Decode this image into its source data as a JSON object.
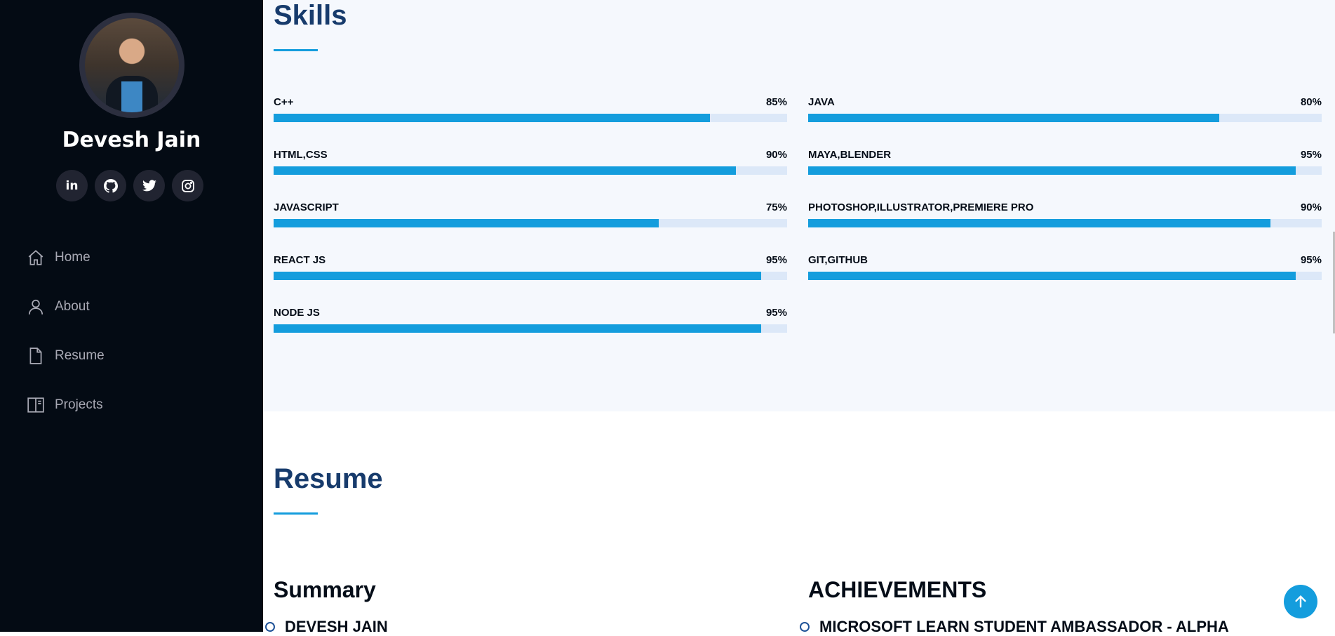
{
  "sidebar": {
    "name": "Devesh Jain",
    "social": [
      {
        "icon": "linkedin-icon",
        "glyph": "in"
      },
      {
        "icon": "github-icon",
        "glyph": ""
      },
      {
        "icon": "twitter-icon",
        "glyph": ""
      },
      {
        "icon": "instagram-icon",
        "glyph": ""
      }
    ],
    "nav": [
      {
        "label": "Home",
        "icon": "home-icon"
      },
      {
        "label": "About",
        "icon": "person-icon"
      },
      {
        "label": "Resume",
        "icon": "file-icon"
      },
      {
        "label": "Projects",
        "icon": "book-icon"
      }
    ]
  },
  "skills": {
    "title": "Skills",
    "left": [
      {
        "name": "C++",
        "percent_label": "85%",
        "value": 85
      },
      {
        "name": "HTML,CSS",
        "percent_label": "90%",
        "value": 90
      },
      {
        "name": "JAVASCRIPT",
        "percent_label": "75%",
        "value": 75
      },
      {
        "name": "REACT JS",
        "percent_label": "95%",
        "value": 95
      },
      {
        "name": "NODE JS",
        "percent_label": "95%",
        "value": 95
      }
    ],
    "right": [
      {
        "name": "JAVA",
        "percent_label": "80%",
        "value": 80
      },
      {
        "name": "MAYA,BLENDER",
        "percent_label": "95%",
        "value": 95
      },
      {
        "name": "PHOTOSHOP,ILLUSTRATOR,PREMIERE PRO",
        "percent_label": "90%",
        "value": 90
      },
      {
        "name": "GIT,GITHUB",
        "percent_label": "95%",
        "value": 95
      }
    ]
  },
  "resume": {
    "title": "Resume",
    "summary_title": "Summary",
    "summary_first_item": "DEVESH JAIN",
    "achievements_title": "ACHIEVEMENTS",
    "achievements_first_item": "MICROSOFT LEARN STUDENT AMBASSADOR - ALPHA"
  },
  "colors": {
    "accent": "#149ddd",
    "sidebar_bg": "#040b14",
    "title": "#173b6c",
    "track": "#dce8f8"
  }
}
